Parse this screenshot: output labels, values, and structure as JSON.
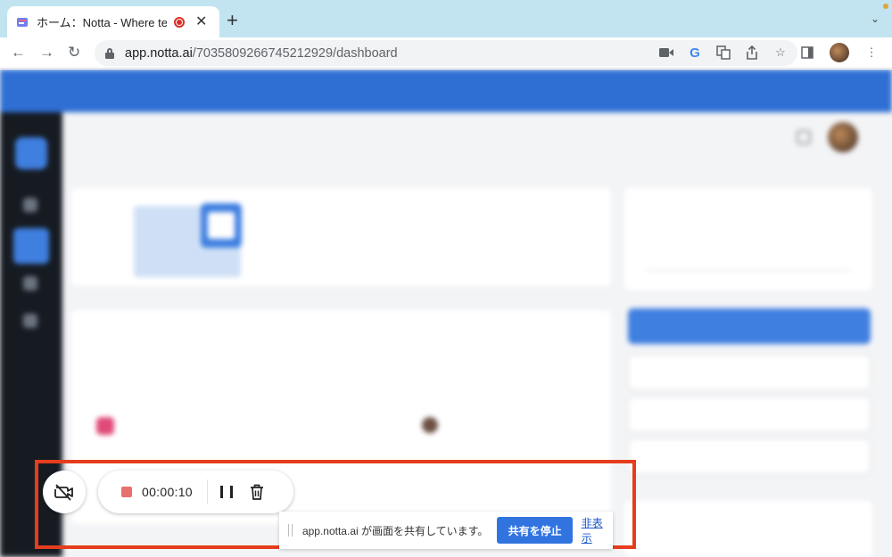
{
  "browser": {
    "tab_title": "ホーム：Notta - Where text",
    "url_host": "app.notta.ai",
    "url_path": "/7035809266745212929/dashboard"
  },
  "recorder": {
    "timer": "00:00:10",
    "recording_color": "#e8706e"
  },
  "share_bar": {
    "message": "app.notta.ai が画面を共有しています。",
    "stop_button": "共有を停止",
    "hide_link": "非表示"
  },
  "colors": {
    "highlight_frame": "#e53d1e",
    "banner": "#2f6fd4",
    "primary_button": "#3174e0"
  }
}
